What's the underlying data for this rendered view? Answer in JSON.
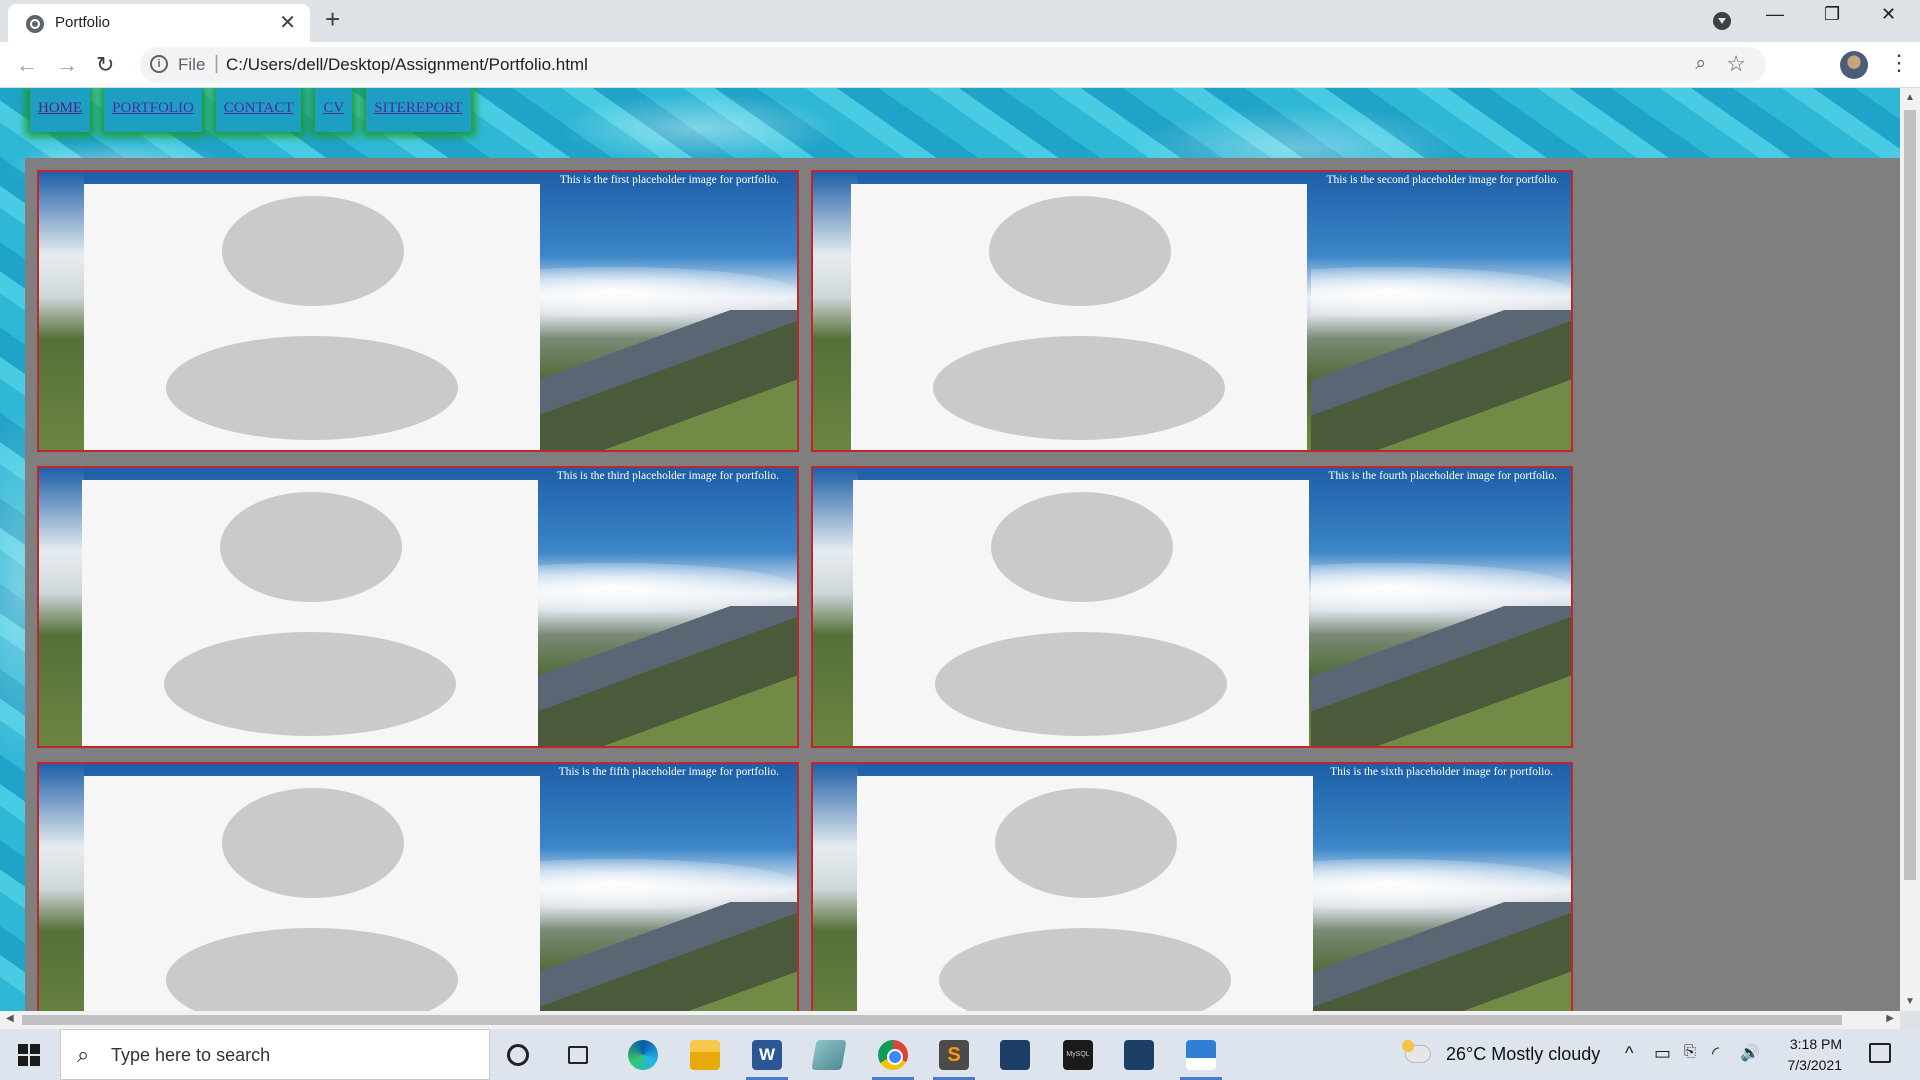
{
  "browser": {
    "tab_title": "Portfolio",
    "tab_close": "✕",
    "new_tab": "+",
    "window_controls": {
      "minimize": "—",
      "maximize": "❐",
      "close": "✕"
    },
    "address": {
      "scheme": "File",
      "separator": "|",
      "url": "C:/Users/dell/Desktop/Assignment/Portfolio.html"
    }
  },
  "nav": {
    "items": [
      "HOME",
      "PORTFOLIO",
      "CONTACT",
      "CV",
      "SITEREPORT"
    ]
  },
  "portfolio": {
    "captions": [
      "This is the first placeholder image for portfolio.",
      "This is the second placeholder image for portfolio.",
      "This is the third placeholder image for portfolio.",
      "This is the fourth placeholder image for portfolio.",
      "This is the fifth placeholder image for portfolio.",
      "This is the sixth placeholder image for portfolio."
    ]
  },
  "taskbar": {
    "search_placeholder": "Type here to search",
    "weather": "26°C  Mostly cloudy",
    "time": "3:18 PM",
    "date": "7/3/2021",
    "icons": [
      "cortana-icon",
      "task-view-icon",
      "edge-icon",
      "file-explorer-icon",
      "word-icon",
      "sticky-notes-icon",
      "chrome-icon",
      "sublime-text-icon",
      "mysql-workbench-icon",
      "mysql-shell-icon",
      "workbench-icon",
      "photos-icon"
    ]
  },
  "tray": {
    "chevron": "^",
    "battery": "▭",
    "network": "◜",
    "volume": "🔊"
  },
  "colors": {
    "card_border": "#c0262c",
    "content_bg": "#7f7f7f",
    "nav_glow": "#1f9a1f"
  }
}
